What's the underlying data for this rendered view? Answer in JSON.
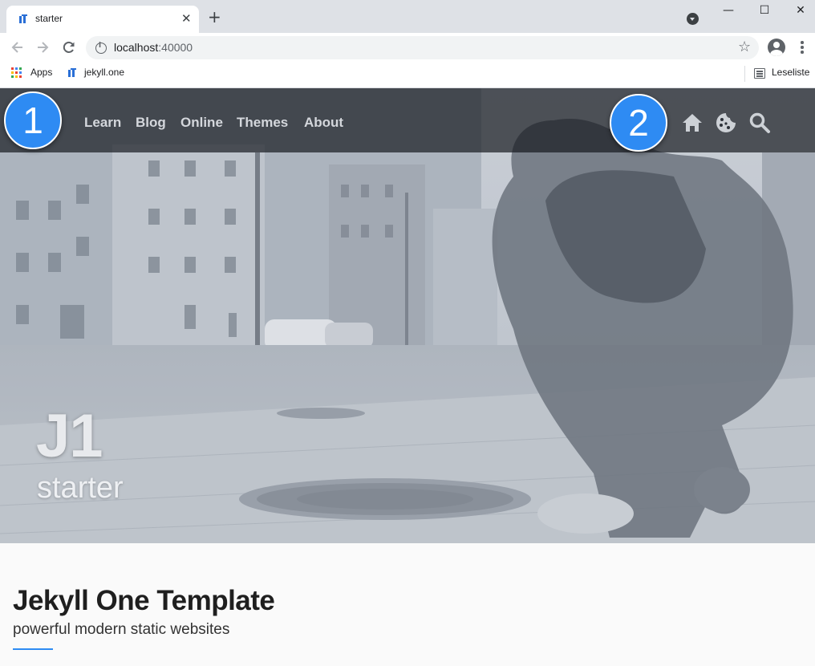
{
  "browser": {
    "tab_title": "starter",
    "tab_close": "✕",
    "new_tab": "+",
    "url_host": "localhost",
    "url_port": ":40000",
    "window_controls": {
      "minimize": "—",
      "maximize": "☐",
      "close": "✕"
    },
    "bookmarks": {
      "apps_label": "Apps",
      "site_label": "jekyll.one",
      "reading_list_label": "Leseliste"
    }
  },
  "page": {
    "nav_links": [
      "Learn",
      "Blog",
      "Online",
      "Themes",
      "About"
    ],
    "nav_actions": [
      "home-icon",
      "cookie-icon",
      "search-icon"
    ],
    "callouts": [
      "1",
      "2"
    ],
    "hero_title": "J1",
    "hero_subtitle": "starter",
    "content_title": "Jekyll One Template",
    "content_subtitle": "powerful modern static websites",
    "colors": {
      "accent": "#2e8bf3",
      "navbar": "#12151b",
      "text": "#1f1f1f"
    }
  }
}
